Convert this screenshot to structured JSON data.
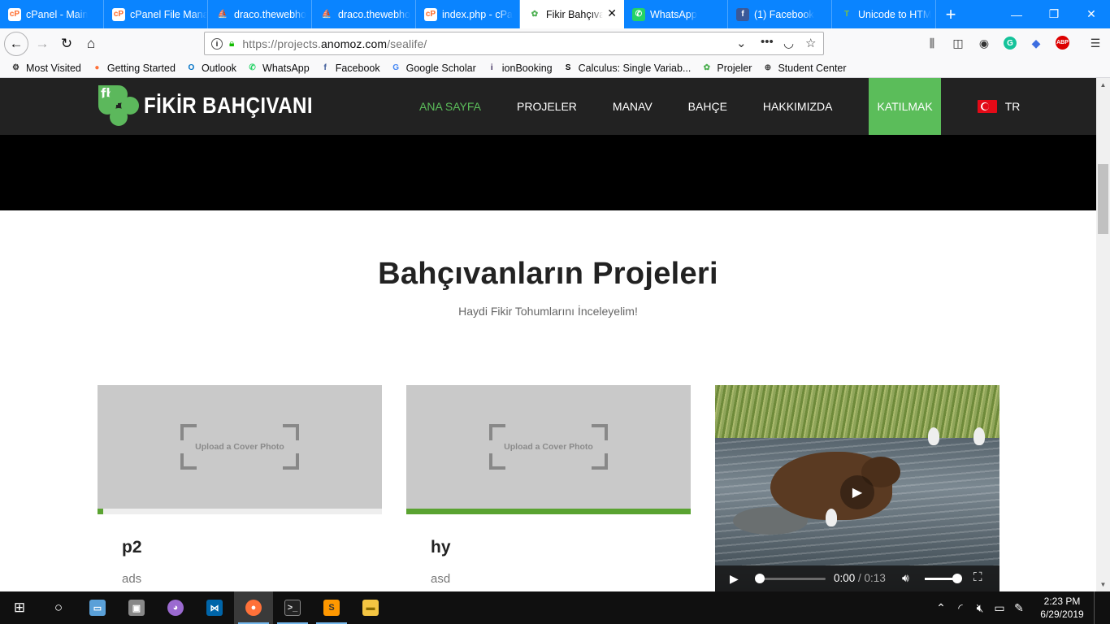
{
  "browser": {
    "tabs": [
      {
        "label": "cPanel - Main",
        "icon": "cpanel-icon",
        "icon_glyph": "cP"
      },
      {
        "label": "cPanel File Mana",
        "icon": "cpanel-icon",
        "icon_glyph": "cP"
      },
      {
        "label": "draco.thewebho",
        "icon": "draco-icon",
        "icon_glyph": "⛵"
      },
      {
        "label": "draco.thewebho",
        "icon": "draco-icon",
        "icon_glyph": "⛵"
      },
      {
        "label": "index.php - cPa",
        "icon": "cpanel-icon",
        "icon_glyph": "cP"
      },
      {
        "label": "Fikir Bahçıvan",
        "icon": "gear-icon",
        "icon_glyph": "✿",
        "active": true
      },
      {
        "label": "WhatsApp",
        "icon": "whatsapp-icon",
        "icon_glyph": "✆"
      },
      {
        "label": "(1) Facebook",
        "icon": "facebook-icon",
        "icon_glyph": "f"
      },
      {
        "label": "Unicode to HTM",
        "icon": "t-icon",
        "icon_glyph": "T"
      }
    ],
    "url": {
      "prefix": "https://projects.",
      "domain": "anomoz.com",
      "path": "/sealife/"
    },
    "bookmarks": [
      {
        "label": "Most Visited",
        "icon": "gear-icon",
        "glyph": "⚙",
        "color": "#333333"
      },
      {
        "label": "Getting Started",
        "icon": "firefox-icon",
        "glyph": "●",
        "color": "#ff7139"
      },
      {
        "label": "Outlook",
        "icon": "outlook-icon",
        "glyph": "O",
        "color": "#0072c6"
      },
      {
        "label": "WhatsApp",
        "icon": "whatsapp-icon",
        "glyph": "✆",
        "color": "#25d366"
      },
      {
        "label": "Facebook",
        "icon": "facebook-icon",
        "glyph": "f",
        "color": "#3b5998"
      },
      {
        "label": "Google Scholar",
        "icon": "scholar-icon",
        "glyph": "G",
        "color": "#4285f4"
      },
      {
        "label": "ionBooking",
        "icon": "ionbooking-icon",
        "glyph": "i",
        "color": "#3b2a5a"
      },
      {
        "label": "Calculus: Single Variab...",
        "icon": "s-icon",
        "glyph": "S",
        "color": "#000000"
      },
      {
        "label": "Projeler",
        "icon": "projeler-icon",
        "glyph": "✿",
        "color": "#4caf50"
      },
      {
        "label": "Student Center",
        "icon": "globe-icon",
        "glyph": "⊕",
        "color": "#444444"
      }
    ]
  },
  "site": {
    "logo_text": "FİKİR BAHÇIVANI",
    "logo_mark": "fb",
    "menu": [
      {
        "label": "ANA SAYFA",
        "active": true
      },
      {
        "label": "PROJELER"
      },
      {
        "label": "MANAV"
      },
      {
        "label": "BAHÇE"
      },
      {
        "label": "HAKKIMIZDA"
      }
    ],
    "join_label": "KATILMAK",
    "lang_label": "TR",
    "section_title": "Bahçıvanların Projeleri",
    "section_subtitle": "Haydi Fikir Tohumlarını İnceleyelim!",
    "cards": [
      {
        "placeholder": "Upload a Cover Photo",
        "title": "p2",
        "desc": "ads",
        "progress": 0.02
      },
      {
        "placeholder": "Upload a Cover Photo",
        "title": "hy",
        "desc": "asd",
        "progress": 1.0
      }
    ],
    "video": {
      "current_time": "0:00",
      "separator": " / ",
      "duration": "0:13"
    }
  },
  "taskbar": {
    "apps": [
      "windows-start-icon",
      "cortana-icon",
      "this-pc-icon",
      "photos-icon",
      "github-icon",
      "vscode-icon",
      "firefox-icon",
      "terminal-icon",
      "sublime-icon",
      "file-explorer-icon"
    ],
    "time": "2:23 PM",
    "date": "6/29/2019"
  },
  "colors": {
    "firefox_blue": "#0a84ff",
    "brand_green": "#5bbd5a",
    "nav_dark": "#222222",
    "progress_green": "#5aa331"
  }
}
